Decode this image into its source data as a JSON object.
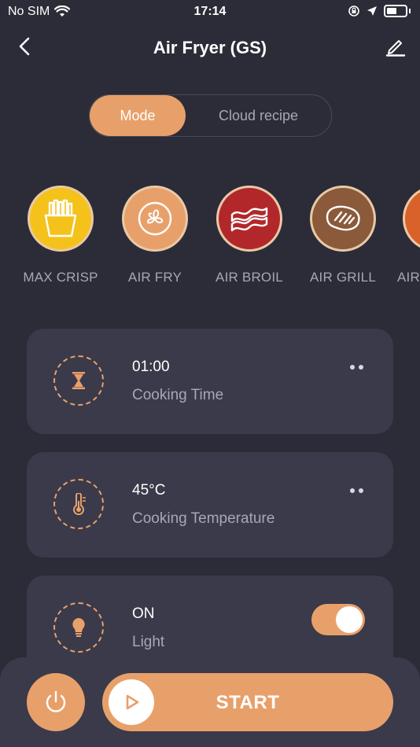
{
  "status_bar": {
    "carrier": "No SIM",
    "time": "17:14"
  },
  "header": {
    "title": "Air Fryer (GS)"
  },
  "tabs": [
    {
      "label": "Mode",
      "active": true
    },
    {
      "label": "Cloud recipe",
      "active": false
    }
  ],
  "modes": [
    {
      "label": "MAX CRISP",
      "icon": "fries-icon",
      "color": "#f4c21b"
    },
    {
      "label": "AIR FRY",
      "icon": "fan-icon",
      "color": "#e8a06a"
    },
    {
      "label": "AIR BROIL",
      "icon": "bacon-icon",
      "color": "#b2282a"
    },
    {
      "label": "AIR GRILL",
      "icon": "steak-icon",
      "color": "#8a5a3a"
    },
    {
      "label": "AIR",
      "icon": "partial-mode-icon",
      "color": "#d9612a"
    }
  ],
  "settings": {
    "time": {
      "value": "01:00",
      "label": "Cooking Time",
      "icon": "hourglass-icon"
    },
    "temperature": {
      "value": "45°C",
      "label": "Cooking Temperature",
      "icon": "thermometer-icon"
    },
    "light": {
      "value": "ON",
      "label": "Light",
      "icon": "lightbulb-icon",
      "enabled": true
    }
  },
  "footer": {
    "start_label": "START",
    "icons": [
      "power-icon",
      "play-icon"
    ]
  },
  "colors": {
    "accent": "#e8a06a",
    "background": "#2c2c38",
    "card": "#3a3a4a",
    "muted_text": "#a7a7b5"
  }
}
